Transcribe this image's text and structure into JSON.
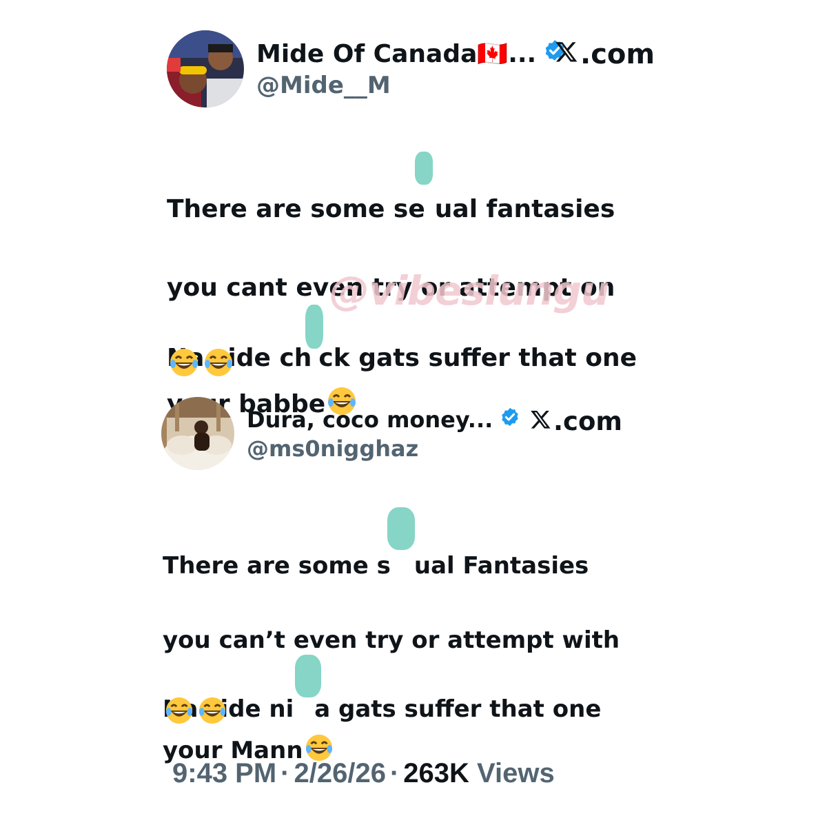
{
  "tweet1": {
    "name": "Mide Of Canada🇨🇦...",
    "handle": "@Mide__M",
    "source": ".com",
    "line1": "There are some se",
    "line1_after": "ual fantasies",
    "line2": "you cant even try or attempt on",
    "line3": "your babbe",
    "line4_a": "Na side ch",
    "line4_b": "ck gats suffer that one"
  },
  "tweet2": {
    "name": "Dura, coco money...",
    "handle": "@ms0nigghaz",
    "source": ".com",
    "line1": "There are some s",
    "line1_after": "ual Fantasies",
    "line2": "you can’t even try or attempt with",
    "line3": "your Mann",
    "line4_a": "Na side ni",
    "line4_b": "a gats suffer that one"
  },
  "watermark": "@vibeslungu",
  "footer": {
    "time": "9:43 PM",
    "date": "2/26/26",
    "views_count": "263K",
    "views_label": "Views"
  },
  "icons": {
    "verified": "verified-badge-icon",
    "x_logo": "x-logo-icon",
    "emoji": "face-with-tears-of-joy-icon"
  },
  "colors": {
    "verified": "#1d9bf0",
    "handle": "#536471",
    "blot": "#7fd3c4",
    "watermark": "#f2c7cf"
  }
}
